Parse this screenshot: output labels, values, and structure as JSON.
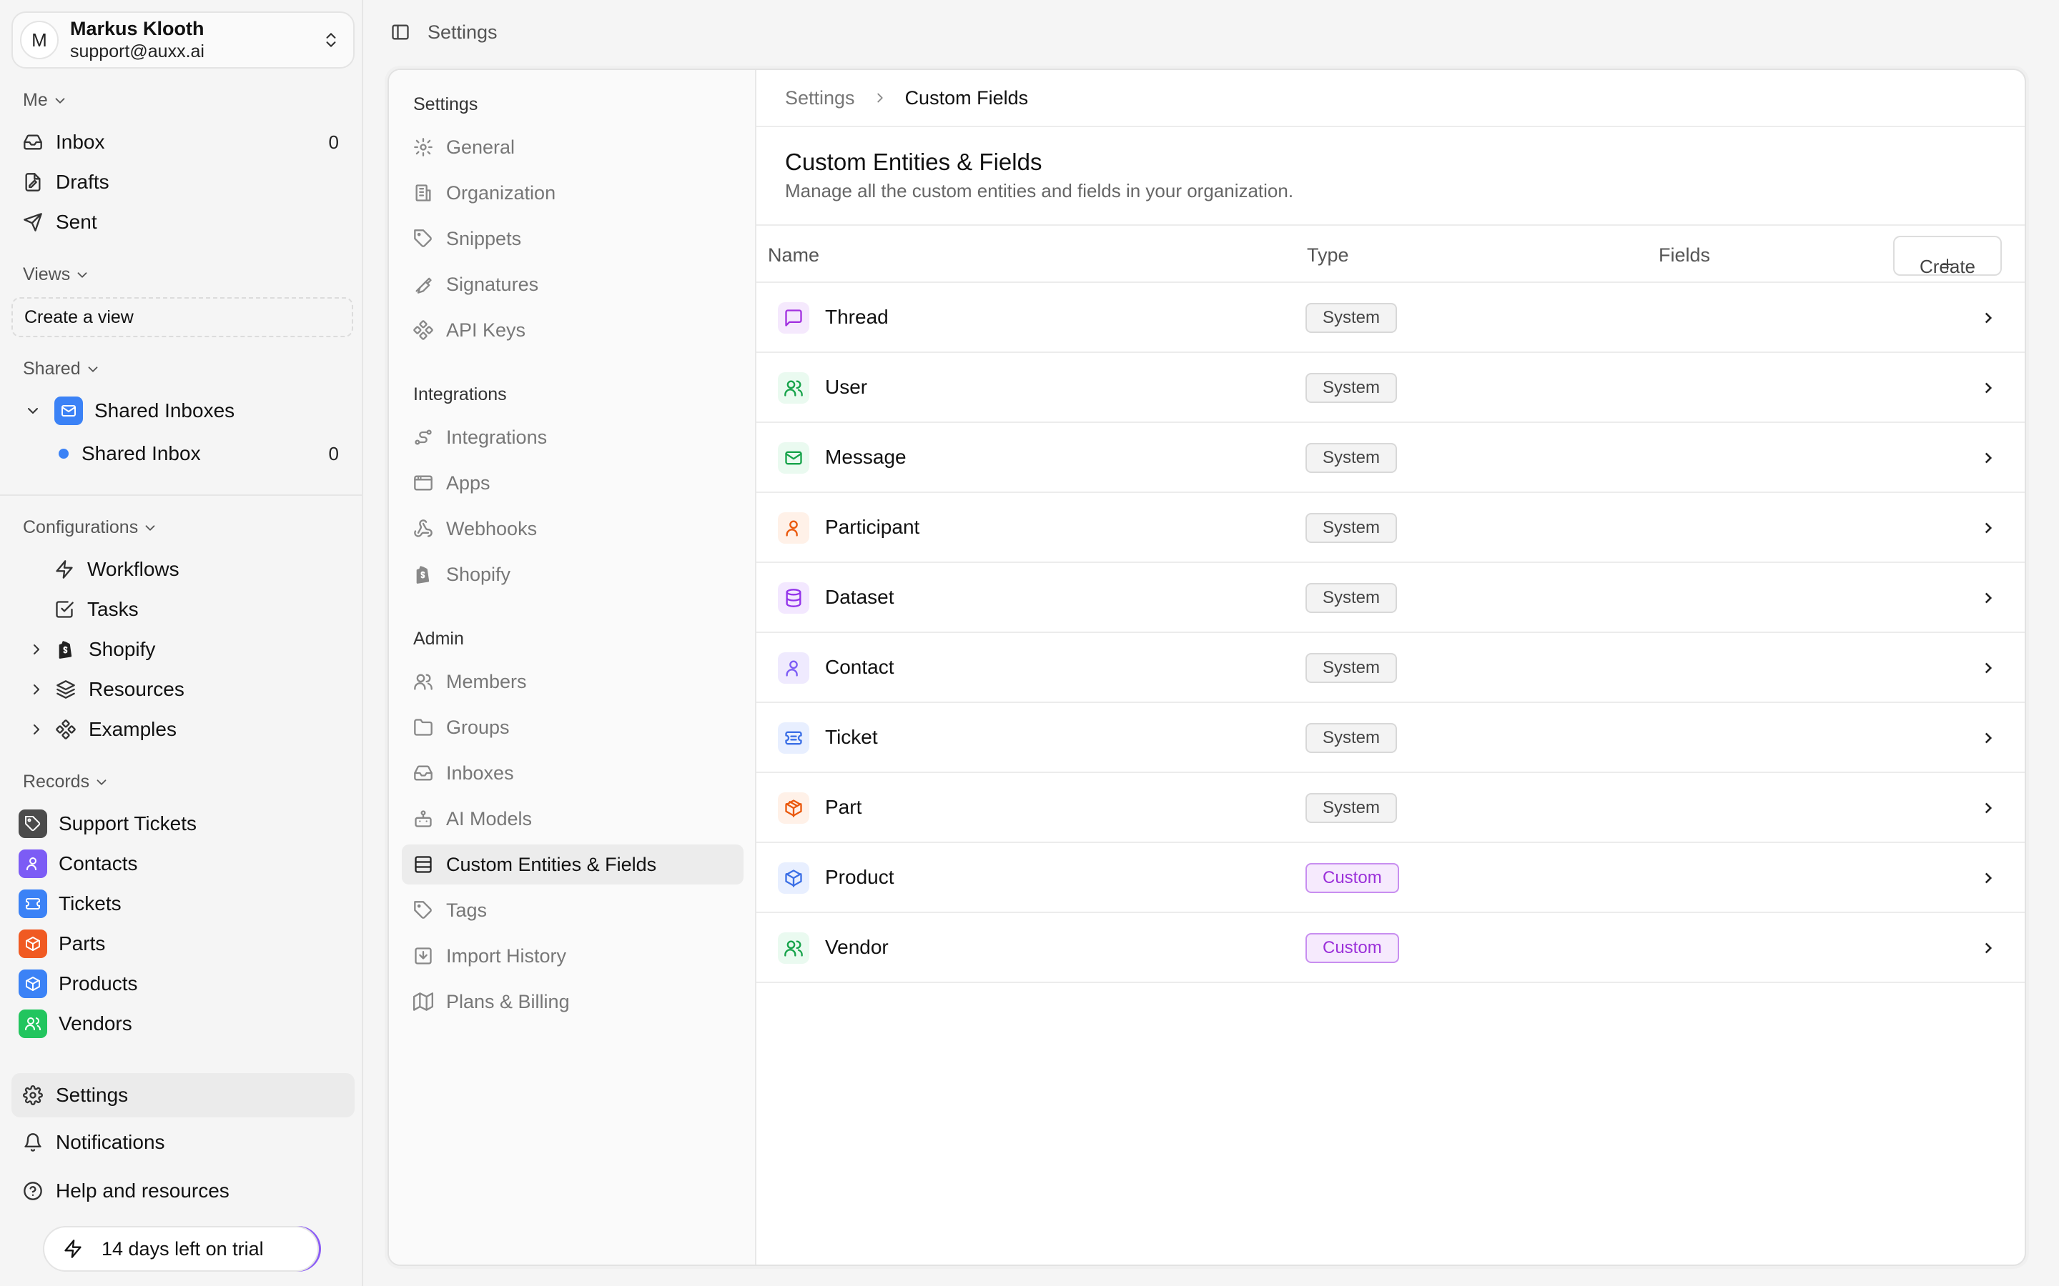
{
  "account": {
    "initial": "M",
    "name": "Markus Klooth",
    "email": "support@auxx.ai"
  },
  "sidebar": {
    "me_label": "Me",
    "me_items": [
      {
        "label": "Inbox",
        "count": "0",
        "icon": "inbox-icon"
      },
      {
        "label": "Drafts",
        "icon": "drafts-icon"
      },
      {
        "label": "Sent",
        "icon": "send-icon"
      }
    ],
    "views_label": "Views",
    "create_view": "Create a view",
    "shared_label": "Shared",
    "shared_group": "Shared Inboxes",
    "shared_inbox": {
      "label": "Shared Inbox",
      "count": "0"
    },
    "config_label": "Configurations",
    "config_items": [
      {
        "label": "Workflows",
        "icon": "zap-icon"
      },
      {
        "label": "Tasks",
        "icon": "check-square-icon"
      },
      {
        "label": "Shopify",
        "icon": "shopify-icon"
      },
      {
        "label": "Resources",
        "icon": "layers-icon"
      },
      {
        "label": "Examples",
        "icon": "workflow-icon"
      }
    ],
    "records_label": "Records",
    "records": [
      {
        "label": "Support Tickets",
        "color": "#4b4b4b"
      },
      {
        "label": "Contacts",
        "color": "#7c5cf5"
      },
      {
        "label": "Tickets",
        "color": "#3b82f6"
      },
      {
        "label": "Parts",
        "color": "#f05a22"
      },
      {
        "label": "Products",
        "color": "#3b82f6"
      },
      {
        "label": "Vendors",
        "color": "#22c55e"
      }
    ],
    "settings": "Settings",
    "notifications": "Notifications",
    "help": "Help and resources",
    "trial": "14 days left on trial"
  },
  "topbar": {
    "title": "Settings"
  },
  "settings_nav": {
    "settings_head": "Settings",
    "settings_items": [
      "General",
      "Organization",
      "Snippets",
      "Signatures",
      "API Keys"
    ],
    "integrations_head": "Integrations",
    "integrations_items": [
      "Integrations",
      "Apps",
      "Webhooks",
      "Shopify"
    ],
    "admin_head": "Admin",
    "admin_items": [
      "Members",
      "Groups",
      "Inboxes",
      "AI Models",
      "Custom Entities & Fields",
      "Tags",
      "Import History",
      "Plans & Billing"
    ]
  },
  "breadcrumb": {
    "root": "Settings",
    "current": "Custom Fields"
  },
  "page": {
    "title": "Custom Entities & Fields",
    "subtitle": "Manage all the custom entities and fields in your organization."
  },
  "table": {
    "headers": {
      "name": "Name",
      "type": "Type",
      "fields": "Fields"
    },
    "create_label": "Create",
    "rows": [
      {
        "name": "Thread",
        "type": "System",
        "icon": "message-square-icon",
        "color": "#a232e0",
        "bg": "#f5e9fd"
      },
      {
        "name": "User",
        "type": "System",
        "icon": "users-icon",
        "color": "#16a34a",
        "bg": "#eafaf0"
      },
      {
        "name": "Message",
        "type": "System",
        "icon": "mail-icon",
        "color": "#16a34a",
        "bg": "#eafaf0"
      },
      {
        "name": "Participant",
        "type": "System",
        "icon": "user-icon",
        "color": "#ea580c",
        "bg": "#fff1e8"
      },
      {
        "name": "Dataset",
        "type": "System",
        "icon": "database-icon",
        "color": "#9333ea",
        "bg": "#f3e8ff"
      },
      {
        "name": "Contact",
        "type": "System",
        "icon": "user-icon",
        "color": "#7c5cf5",
        "bg": "#efeafe"
      },
      {
        "name": "Ticket",
        "type": "System",
        "icon": "ticket-icon",
        "color": "#3b6fe6",
        "bg": "#e8efff"
      },
      {
        "name": "Part",
        "type": "System",
        "icon": "package-icon",
        "color": "#ea580c",
        "bg": "#fff1e8"
      },
      {
        "name": "Product",
        "type": "Custom",
        "icon": "box-icon",
        "color": "#3b6fe6",
        "bg": "#e8efff"
      },
      {
        "name": "Vendor",
        "type": "Custom",
        "icon": "users-icon",
        "color": "#16a34a",
        "bg": "#eafaf0"
      }
    ]
  }
}
